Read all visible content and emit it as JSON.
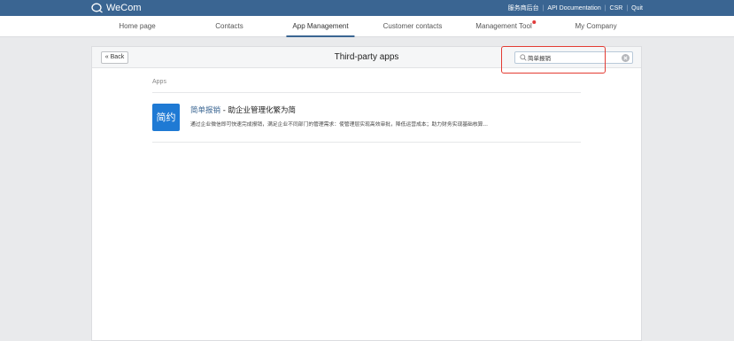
{
  "app": {
    "logo_text": "WeCom"
  },
  "top_links": [
    "服务商后台",
    "API Documentation",
    "CSR",
    "Quit"
  ],
  "nav": {
    "tabs": [
      {
        "label": "Home page"
      },
      {
        "label": "Contacts"
      },
      {
        "label": "App Management"
      },
      {
        "label": "Customer contacts"
      },
      {
        "label": "Management Tool"
      },
      {
        "label": "My Company"
      }
    ]
  },
  "panel": {
    "back_label": "« Back",
    "title": "Third-party apps",
    "search_value": "简单报销"
  },
  "section": {
    "label": "Apps"
  },
  "results": [
    {
      "icon_text": "简约",
      "name": "简单报销",
      "separator": " - ",
      "tagline": "助企业管理化繁为简",
      "description": "通过企业微信即可快速完成报销，满足企业不同部门的管理需求：使管理层实现高效审批，降低运营成本；助力财务实现基础核算..."
    }
  ],
  "colors": {
    "topbar": "#3a6592",
    "accent": "#3a6592",
    "highlight": "#e33b33",
    "notification_dot": "#e03a3a",
    "app_icon": "#1f7ad4"
  },
  "icons": {
    "logo": "wecom-logo-icon",
    "search": "search-icon",
    "clear": "clear-icon",
    "notification": "notification-dot-icon"
  }
}
